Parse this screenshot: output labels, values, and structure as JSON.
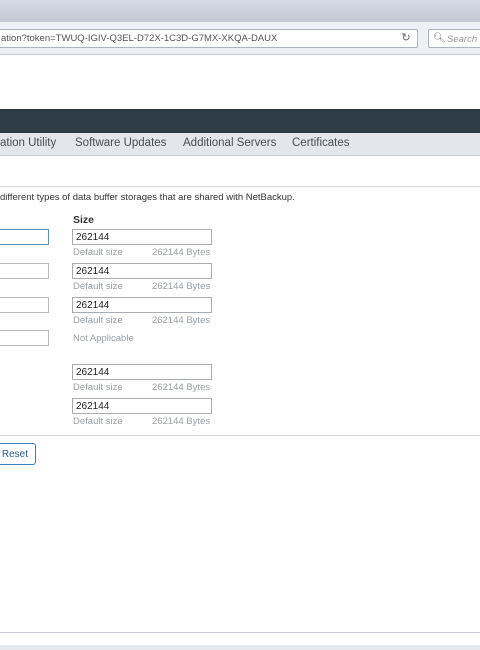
{
  "browser": {
    "url": "ation?token=TWUQ-IGIV-Q3EL-D72X-1C3D-G7MX-XKQA-DAUX",
    "search_placeholder": "Search"
  },
  "tabs": [
    {
      "label": "ation Utility"
    },
    {
      "label": "Software Updates"
    },
    {
      "label": "Additional Servers"
    },
    {
      "label": "Certificates"
    }
  ],
  "description": "different types of data buffer storages that are shared with NetBackup.",
  "size_header": "Size",
  "rows": [
    {
      "value": "262144",
      "hint_left": "Default size",
      "hint_right": "262144 Bytes"
    },
    {
      "value": "262144",
      "hint_left": "Default size",
      "hint_right": "262144 Bytes"
    },
    {
      "value": "262144",
      "hint_left": "Default size",
      "hint_right": "262144 Bytes"
    },
    {
      "value": "",
      "hint_left": "Not Applicable",
      "hint_right": ""
    },
    {
      "value": "262144",
      "hint_left": "Default size",
      "hint_right": "262144 Bytes"
    },
    {
      "value": "262144",
      "hint_left": "Default size",
      "hint_right": "262144 Bytes"
    }
  ],
  "reset_label": "Reset"
}
